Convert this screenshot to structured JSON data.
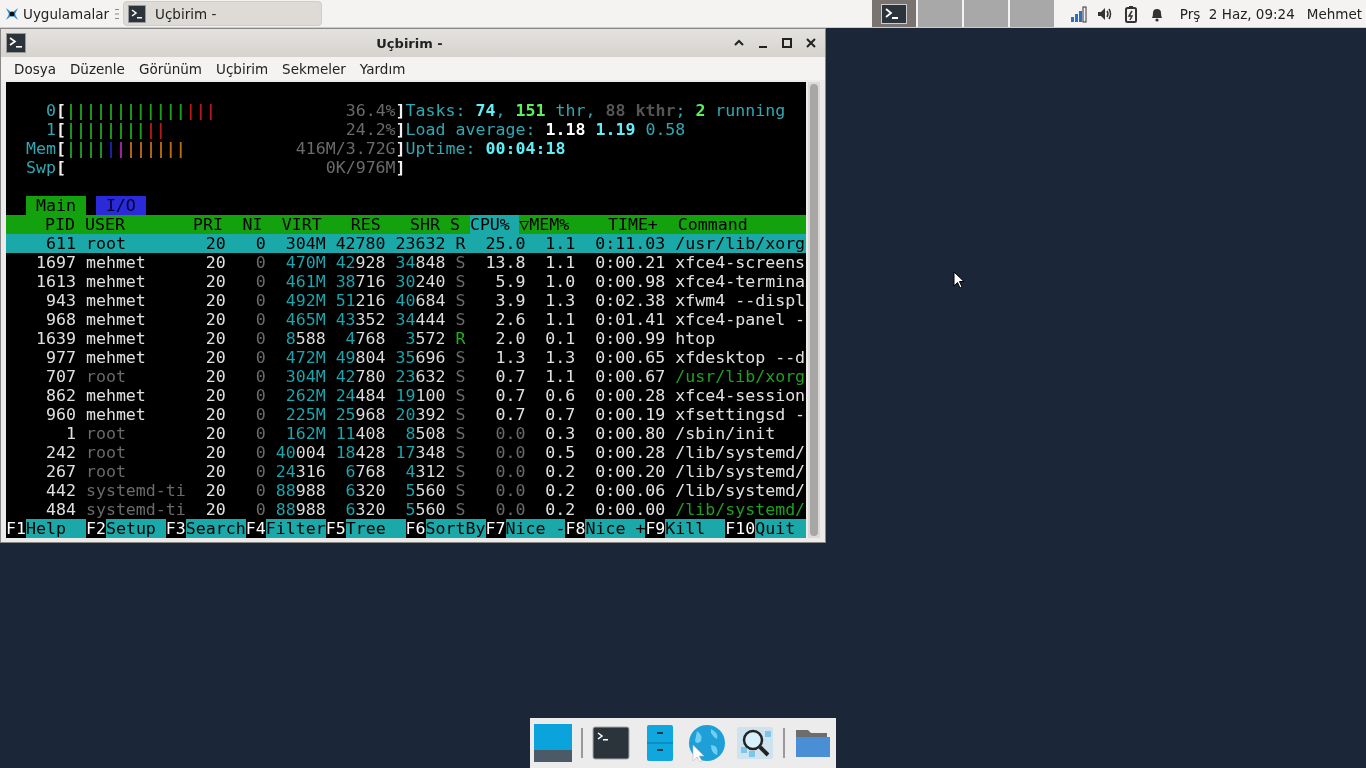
{
  "top_panel": {
    "apps_menu": "Uygulamalar",
    "task_button": {
      "label": "Uçbirim -",
      "selected": true
    },
    "workspaces": [
      {
        "selected": true
      },
      {
        "selected": false
      },
      {
        "selected": false
      },
      {
        "selected": false
      }
    ],
    "clock": "Prş  2 Haz, 09:24",
    "user": "Mehmet"
  },
  "window": {
    "title": "Uçbirim -",
    "menu": [
      "Dosya",
      "Düzenle",
      "Görünüm",
      "Uçbirim",
      "Sekmeler",
      "Yardım"
    ]
  },
  "htop": {
    "meters": [
      {
        "label": "0",
        "open": "[",
        "value": "36.4%",
        "close": "]",
        "segments": [
          {
            "text": "||||||||||||",
            "color": "#1ca01c"
          },
          {
            "text": "|||",
            "color": "#b81818"
          }
        ]
      },
      {
        "label": "1",
        "open": "[",
        "value": "24.2%",
        "close": "]",
        "segments": [
          {
            "text": "||||||||",
            "color": "#1ca01c"
          },
          {
            "text": "||",
            "color": "#b81818"
          }
        ]
      },
      {
        "label": "Mem",
        "open": "[",
        "value": "416M/3.72G",
        "close": "]",
        "segments": [
          {
            "text": "||||",
            "color": "#1ca01c"
          },
          {
            "text": "|",
            "color": "#2020b8"
          },
          {
            "text": "|",
            "color": "#b020b0"
          },
          {
            "text": "||||||",
            "color": "#c06a10"
          }
        ]
      },
      {
        "label": "Swp",
        "open": "[",
        "value": "0K/976M",
        "close": "]"
      }
    ],
    "info": [
      [
        {
          "text": "Tasks: ",
          "kind": "label"
        },
        {
          "text": "74",
          "kind": "value"
        },
        {
          "text": ", ",
          "kind": "label"
        },
        {
          "text": "151",
          "kind": "count"
        },
        {
          "text": " thr, ",
          "kind": "label"
        },
        {
          "text": "88 kthr",
          "kind": "muted"
        },
        {
          "text": "; ",
          "kind": "label"
        },
        {
          "text": "2",
          "kind": "count"
        },
        {
          "text": " running",
          "kind": "label"
        }
      ],
      [
        {
          "text": "Load average: ",
          "kind": "label"
        },
        {
          "text": "1.18 ",
          "kind": "strong"
        },
        {
          "text": "1.19 ",
          "kind": "value"
        },
        {
          "text": "0.58",
          "kind": "label"
        }
      ],
      [
        {
          "text": "Uptime: ",
          "kind": "label"
        },
        {
          "text": "00:04:18",
          "kind": "value"
        }
      ]
    ],
    "tabs": [
      {
        "label": "Main",
        "selected": true
      },
      {
        "label": "I/O",
        "selected": false
      }
    ],
    "columns": [
      {
        "label": "PID",
        "sorted": false
      },
      {
        "label": "USER",
        "sorted": false
      },
      {
        "label": "PRI",
        "sorted": false
      },
      {
        "label": "NI",
        "sorted": false
      },
      {
        "label": "VIRT",
        "sorted": false
      },
      {
        "label": "RES",
        "sorted": false
      },
      {
        "label": "SHR",
        "sorted": false
      },
      {
        "label": "S",
        "sorted": false
      },
      {
        "label": "CPU%",
        "sorted": true
      },
      {
        "label": "▽MEM%",
        "sorted": false
      },
      {
        "label": "TIME+",
        "sorted": false
      },
      {
        "label": "Command",
        "sorted": false
      }
    ],
    "rows": [
      {
        "cells": [
          "611",
          "root",
          "20",
          "0",
          "304M",
          "42780",
          "23632",
          "R",
          "25.0",
          "1.1",
          "0:11.03",
          "/usr/lib/xorg"
        ],
        "selected": true
      },
      {
        "cells": [
          "1697",
          "mehmet",
          "20",
          "0",
          "470M",
          "42928",
          "34848",
          "S",
          "13.8",
          "1.1",
          "0:00.21",
          "xfce4-screens"
        ],
        "selected": false,
        "running": false,
        "system_user": false,
        "idle": false,
        "kind": "process"
      },
      {
        "cells": [
          "1613",
          "mehmet",
          "20",
          "0",
          "461M",
          "38716",
          "30240",
          "S",
          "5.9",
          "1.0",
          "0:00.98",
          "xfce4-termina"
        ],
        "selected": false,
        "running": false,
        "system_user": false,
        "idle": false,
        "kind": "process"
      },
      {
        "cells": [
          "943",
          "mehmet",
          "20",
          "0",
          "492M",
          "51216",
          "40684",
          "S",
          "3.9",
          "1.3",
          "0:02.38",
          "xfwm4 --displ"
        ],
        "selected": false,
        "running": false,
        "system_user": false,
        "idle": false,
        "kind": "process"
      },
      {
        "cells": [
          "968",
          "mehmet",
          "20",
          "0",
          "465M",
          "43352",
          "34444",
          "S",
          "2.6",
          "1.1",
          "0:01.41",
          "xfce4-panel -"
        ],
        "selected": false,
        "running": false,
        "system_user": false,
        "idle": false,
        "kind": "process"
      },
      {
        "cells": [
          "1639",
          "mehmet",
          "20",
          "0",
          "8588",
          "4768",
          "3572",
          "R",
          "2.0",
          "0.1",
          "0:00.99",
          "htop"
        ],
        "selected": false,
        "running": true,
        "system_user": false,
        "idle": false,
        "kind": "process"
      },
      {
        "cells": [
          "977",
          "mehmet",
          "20",
          "0",
          "472M",
          "49804",
          "35696",
          "S",
          "1.3",
          "1.3",
          "0:00.65",
          "xfdesktop --d"
        ],
        "selected": false,
        "running": false,
        "system_user": false,
        "idle": false,
        "kind": "process"
      },
      {
        "cells": [
          "707",
          "root",
          "20",
          "0",
          "304M",
          "42780",
          "23632",
          "S",
          "0.7",
          "1.1",
          "0:00.67",
          "/usr/lib/xorg"
        ],
        "selected": false,
        "running": false,
        "system_user": true,
        "idle": false,
        "kind": "thread"
      },
      {
        "cells": [
          "862",
          "mehmet",
          "20",
          "0",
          "262M",
          "24484",
          "19100",
          "S",
          "0.7",
          "0.6",
          "0:00.28",
          "xfce4-session"
        ],
        "selected": false,
        "running": false,
        "system_user": false,
        "idle": false,
        "kind": "process"
      },
      {
        "cells": [
          "960",
          "mehmet",
          "20",
          "0",
          "225M",
          "25968",
          "20392",
          "S",
          "0.7",
          "0.7",
          "0:00.19",
          "xfsettingsd -"
        ],
        "selected": false,
        "running": false,
        "system_user": false,
        "idle": false,
        "kind": "process"
      },
      {
        "cells": [
          "1",
          "root",
          "20",
          "0",
          "162M",
          "11408",
          "8508",
          "S",
          "0.0",
          "0.3",
          "0:00.80",
          "/sbin/init"
        ],
        "selected": false,
        "running": false,
        "system_user": true,
        "idle": true,
        "kind": "process"
      },
      {
        "cells": [
          "242",
          "root",
          "20",
          "0",
          "40004",
          "18428",
          "17348",
          "S",
          "0.0",
          "0.5",
          "0:00.28",
          "/lib/systemd/"
        ],
        "selected": false,
        "running": false,
        "system_user": true,
        "idle": true,
        "kind": "process"
      },
      {
        "cells": [
          "267",
          "root",
          "20",
          "0",
          "24316",
          "6768",
          "4312",
          "S",
          "0.0",
          "0.2",
          "0:00.20",
          "/lib/systemd/"
        ],
        "selected": false,
        "running": false,
        "system_user": true,
        "idle": true,
        "kind": "process"
      },
      {
        "cells": [
          "442",
          "systemd-ti",
          "20",
          "0",
          "88988",
          "6320",
          "5560",
          "S",
          "0.0",
          "0.2",
          "0:00.06",
          "/lib/systemd/"
        ],
        "selected": false,
        "running": false,
        "system_user": true,
        "idle": true,
        "kind": "process"
      },
      {
        "cells": [
          "484",
          "systemd-ti",
          "20",
          "0",
          "88988",
          "6320",
          "5560",
          "S",
          "0.0",
          "0.2",
          "0:00.00",
          "/lib/systemd/"
        ],
        "selected": false,
        "running": false,
        "system_user": true,
        "idle": true,
        "kind": "thread"
      }
    ],
    "function_keys": [
      {
        "key": "F1",
        "label": "Help"
      },
      {
        "key": "F2",
        "label": "Setup"
      },
      {
        "key": "F3",
        "label": "Search"
      },
      {
        "key": "F4",
        "label": "Filter"
      },
      {
        "key": "F5",
        "label": "Tree"
      },
      {
        "key": "F6",
        "label": "SortBy"
      },
      {
        "key": "F7",
        "label": "Nice -"
      },
      {
        "key": "F8",
        "label": "Nice +"
      },
      {
        "key": "F9",
        "label": "Kill"
      },
      {
        "key": "F10",
        "label": "Quit"
      }
    ]
  }
}
